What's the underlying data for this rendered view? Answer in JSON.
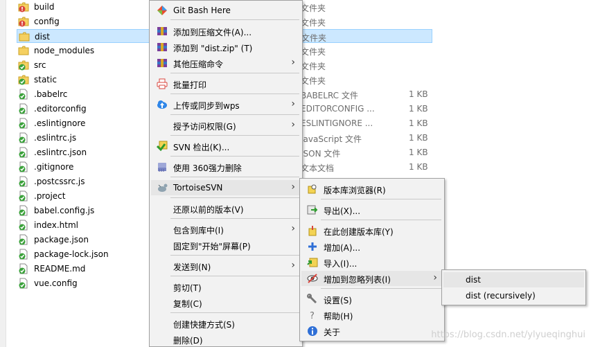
{
  "files": [
    {
      "name": "build",
      "icon": "folder-warning-icon",
      "type": "文件夹",
      "size": ""
    },
    {
      "name": "config",
      "icon": "folder-warning-icon",
      "type": "文件夹",
      "size": ""
    },
    {
      "name": "dist",
      "icon": "folder-unversioned-icon",
      "type": "文件夹",
      "size": ""
    },
    {
      "name": "node_modules",
      "icon": "folder-unversioned-icon",
      "type": "文件夹",
      "size": ""
    },
    {
      "name": "src",
      "icon": "folder-ok-icon",
      "type": "文件夹",
      "size": ""
    },
    {
      "name": "static",
      "icon": "folder-ok-icon",
      "type": "文件夹",
      "size": ""
    },
    {
      "name": ".babelrc",
      "icon": "file-ok-icon",
      "type": "BABELRC 文件",
      "size": "1 KB"
    },
    {
      "name": ".editorconfig",
      "icon": "file-ok-icon",
      "type": "EDITORCONFIG ...",
      "size": "1 KB"
    },
    {
      "name": ".eslintignore",
      "icon": "file-ok-icon",
      "type": "ESLINTIGNORE ...",
      "size": "1 KB"
    },
    {
      "name": ".eslintrc.js",
      "icon": "file-ok-icon",
      "type": "JavaScript 文件",
      "size": "1 KB"
    },
    {
      "name": ".eslintrc.json",
      "icon": "file-ok-icon",
      "type": "JSON 文件",
      "size": "1 KB"
    },
    {
      "name": ".gitignore",
      "icon": "file-ok-icon",
      "type": "文本文档",
      "size": "1 KB"
    },
    {
      "name": ".postcssrc.js",
      "icon": "file-ok-icon",
      "type": "",
      "size": ""
    },
    {
      "name": ".project",
      "icon": "file-ok-icon",
      "type": "",
      "size": ""
    },
    {
      "name": "babel.config.js",
      "icon": "file-ok-icon",
      "type": "",
      "size": ""
    },
    {
      "name": "index.html",
      "icon": "file-ok-icon",
      "type": "",
      "size": ""
    },
    {
      "name": "package.json",
      "icon": "file-ok-icon",
      "type": "",
      "size": ""
    },
    {
      "name": "package-lock.json",
      "icon": "file-ok-icon",
      "type": "",
      "size": ""
    },
    {
      "name": "README.md",
      "icon": "file-ok-icon",
      "type": "",
      "size": ""
    },
    {
      "name": "vue.config",
      "icon": "file-ok-icon",
      "type": "",
      "size": ""
    }
  ],
  "context_menu": {
    "items": {
      "git_bash": "Git Bash Here",
      "add_archive": "添加到压缩文件(A)...",
      "add_dist_zip": "添加到 \"dist.zip\" (T)",
      "other_compress": "其他压缩命令",
      "batch_print": "批量打印",
      "upload_wps": "上传或同步到wps",
      "grant_access": "授予访问权限(G)",
      "svn_checkout": "SVN 检出(K)...",
      "delete_360": "使用 360强力删除",
      "tortoise": "TortoiseSVN",
      "restore": "还原以前的版本(V)",
      "include_lib": "包含到库中(I)",
      "pin_start": "固定到\"开始\"屏幕(P)",
      "send_to": "发送到(N)",
      "cut": "剪切(T)",
      "copy": "复制(C)",
      "shortcut": "创建快捷方式(S)",
      "delete": "删除(D)"
    }
  },
  "svn_menu": {
    "repo_browser": "版本库浏览器(R)",
    "export": "导出(X)...",
    "create_repo": "在此创建版本库(Y)",
    "add": "增加(A)...",
    "import": "导入(I)...",
    "ignore": "增加到忽略列表(I)",
    "settings": "设置(S)",
    "help": "帮助(H)",
    "about": "关于"
  },
  "ignore_menu": {
    "dist": "dist",
    "dist_recursive": "dist (recursively)"
  },
  "watermark": "https://blog.csdn.net/ylyueqinghui"
}
